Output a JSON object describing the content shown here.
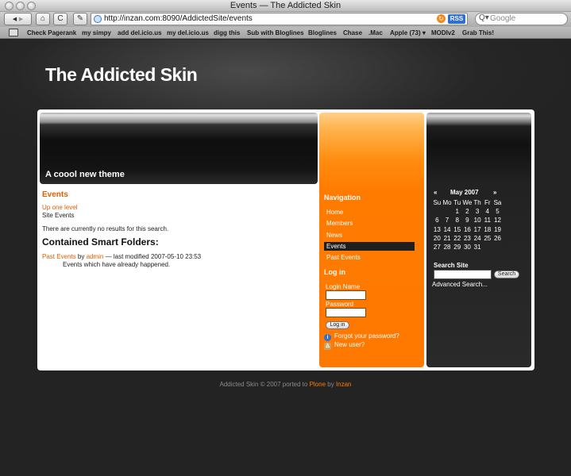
{
  "window": {
    "title": "Events — The Addicted Skin"
  },
  "toolbar": {
    "back_glyph": "◀",
    "forward_glyph": "▶",
    "home_glyph": "⌂",
    "reload_glyph": "C",
    "edit_glyph": "✎",
    "url": "http://inzan.com:8090/AddictedSite/events",
    "rss_label": "RSS",
    "url_reload_glyph": "↻",
    "search_placeholder": "Google",
    "search_glyph": "Q▾"
  },
  "bookmarks": [
    "Check Pagerank",
    "my simpy",
    "add del.icio.us",
    "my del.icio.us",
    "digg this",
    "Sub with Bloglines",
    "Bloglines",
    "Chase",
    ".Mac",
    "Apple (73) ▾",
    "MODIv2",
    "Grab This!"
  ],
  "site": {
    "title": "The Addicted Skin",
    "banner_caption": "A coool new theme"
  },
  "content": {
    "heading": "Events",
    "up_link": "Up one level",
    "site_events": "Site Events",
    "no_results": "There are currently no results for this search.",
    "folders_heading": "Contained Smart Folders:",
    "folder": {
      "title": "Past Events",
      "by": " by ",
      "author": "admin",
      "modified": " — last modified 2007-05-10 23:53",
      "description": "Events which have already happened."
    }
  },
  "navigation": {
    "heading": "Navigation",
    "items": [
      {
        "label": "Home",
        "active": false
      },
      {
        "label": "Members",
        "active": false
      },
      {
        "label": "News",
        "active": false
      },
      {
        "label": "Events",
        "active": true
      },
      {
        "label": "Past Events",
        "active": false
      }
    ]
  },
  "login": {
    "heading": "Log in",
    "name_label": "Login Name",
    "password_label": "Password",
    "button": "Log in",
    "forgot": "Forgot your password?",
    "new_user": "New user?",
    "forgot_icon": "info-icon",
    "new_user_icon": "user-icon"
  },
  "calendar": {
    "prev": "«",
    "title": "May 2007",
    "next": "»",
    "weekdays": [
      "Su",
      "Mo",
      "Tu",
      "We",
      "Th",
      "Fr",
      "Sa"
    ],
    "weeks": [
      [
        "",
        "",
        "1",
        "2",
        "3",
        "4",
        "5"
      ],
      [
        "6",
        "7",
        "8",
        "9",
        "10",
        "11",
        "12"
      ],
      [
        "13",
        "14",
        "15",
        "16",
        "17",
        "18",
        "19"
      ],
      [
        "20",
        "21",
        "22",
        "23",
        "24",
        "25",
        "26"
      ],
      [
        "27",
        "28",
        "29",
        "30",
        "31",
        "",
        ""
      ]
    ]
  },
  "search": {
    "label": "Search Site",
    "button": "Search",
    "advanced": "Advanced Search..."
  },
  "footer": {
    "prefix": "Addicted Skin © 2007 ported to ",
    "plone": "Plone",
    "by": " by ",
    "inzan": "Inzan"
  },
  "colors": {
    "accent": "#ff7800",
    "link": "#e55e00",
    "background": "#262626"
  }
}
